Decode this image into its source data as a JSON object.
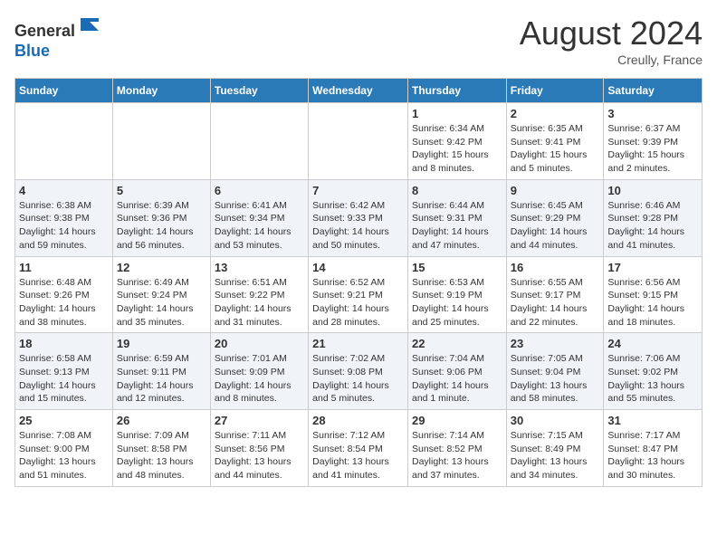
{
  "header": {
    "logo_line1": "General",
    "logo_line2": "Blue",
    "month_year": "August 2024",
    "location": "Creully, France"
  },
  "days_of_week": [
    "Sunday",
    "Monday",
    "Tuesday",
    "Wednesday",
    "Thursday",
    "Friday",
    "Saturday"
  ],
  "weeks": [
    [
      {
        "day": "",
        "sunrise": "",
        "sunset": "",
        "daylight": ""
      },
      {
        "day": "",
        "sunrise": "",
        "sunset": "",
        "daylight": ""
      },
      {
        "day": "",
        "sunrise": "",
        "sunset": "",
        "daylight": ""
      },
      {
        "day": "",
        "sunrise": "",
        "sunset": "",
        "daylight": ""
      },
      {
        "day": "1",
        "sunrise": "Sunrise: 6:34 AM",
        "sunset": "Sunset: 9:42 PM",
        "daylight": "Daylight: 15 hours and 8 minutes."
      },
      {
        "day": "2",
        "sunrise": "Sunrise: 6:35 AM",
        "sunset": "Sunset: 9:41 PM",
        "daylight": "Daylight: 15 hours and 5 minutes."
      },
      {
        "day": "3",
        "sunrise": "Sunrise: 6:37 AM",
        "sunset": "Sunset: 9:39 PM",
        "daylight": "Daylight: 15 hours and 2 minutes."
      }
    ],
    [
      {
        "day": "4",
        "sunrise": "Sunrise: 6:38 AM",
        "sunset": "Sunset: 9:38 PM",
        "daylight": "Daylight: 14 hours and 59 minutes."
      },
      {
        "day": "5",
        "sunrise": "Sunrise: 6:39 AM",
        "sunset": "Sunset: 9:36 PM",
        "daylight": "Daylight: 14 hours and 56 minutes."
      },
      {
        "day": "6",
        "sunrise": "Sunrise: 6:41 AM",
        "sunset": "Sunset: 9:34 PM",
        "daylight": "Daylight: 14 hours and 53 minutes."
      },
      {
        "day": "7",
        "sunrise": "Sunrise: 6:42 AM",
        "sunset": "Sunset: 9:33 PM",
        "daylight": "Daylight: 14 hours and 50 minutes."
      },
      {
        "day": "8",
        "sunrise": "Sunrise: 6:44 AM",
        "sunset": "Sunset: 9:31 PM",
        "daylight": "Daylight: 14 hours and 47 minutes."
      },
      {
        "day": "9",
        "sunrise": "Sunrise: 6:45 AM",
        "sunset": "Sunset: 9:29 PM",
        "daylight": "Daylight: 14 hours and 44 minutes."
      },
      {
        "day": "10",
        "sunrise": "Sunrise: 6:46 AM",
        "sunset": "Sunset: 9:28 PM",
        "daylight": "Daylight: 14 hours and 41 minutes."
      }
    ],
    [
      {
        "day": "11",
        "sunrise": "Sunrise: 6:48 AM",
        "sunset": "Sunset: 9:26 PM",
        "daylight": "Daylight: 14 hours and 38 minutes."
      },
      {
        "day": "12",
        "sunrise": "Sunrise: 6:49 AM",
        "sunset": "Sunset: 9:24 PM",
        "daylight": "Daylight: 14 hours and 35 minutes."
      },
      {
        "day": "13",
        "sunrise": "Sunrise: 6:51 AM",
        "sunset": "Sunset: 9:22 PM",
        "daylight": "Daylight: 14 hours and 31 minutes."
      },
      {
        "day": "14",
        "sunrise": "Sunrise: 6:52 AM",
        "sunset": "Sunset: 9:21 PM",
        "daylight": "Daylight: 14 hours and 28 minutes."
      },
      {
        "day": "15",
        "sunrise": "Sunrise: 6:53 AM",
        "sunset": "Sunset: 9:19 PM",
        "daylight": "Daylight: 14 hours and 25 minutes."
      },
      {
        "day": "16",
        "sunrise": "Sunrise: 6:55 AM",
        "sunset": "Sunset: 9:17 PM",
        "daylight": "Daylight: 14 hours and 22 minutes."
      },
      {
        "day": "17",
        "sunrise": "Sunrise: 6:56 AM",
        "sunset": "Sunset: 9:15 PM",
        "daylight": "Daylight: 14 hours and 18 minutes."
      }
    ],
    [
      {
        "day": "18",
        "sunrise": "Sunrise: 6:58 AM",
        "sunset": "Sunset: 9:13 PM",
        "daylight": "Daylight: 14 hours and 15 minutes."
      },
      {
        "day": "19",
        "sunrise": "Sunrise: 6:59 AM",
        "sunset": "Sunset: 9:11 PM",
        "daylight": "Daylight: 14 hours and 12 minutes."
      },
      {
        "day": "20",
        "sunrise": "Sunrise: 7:01 AM",
        "sunset": "Sunset: 9:09 PM",
        "daylight": "Daylight: 14 hours and 8 minutes."
      },
      {
        "day": "21",
        "sunrise": "Sunrise: 7:02 AM",
        "sunset": "Sunset: 9:08 PM",
        "daylight": "Daylight: 14 hours and 5 minutes."
      },
      {
        "day": "22",
        "sunrise": "Sunrise: 7:04 AM",
        "sunset": "Sunset: 9:06 PM",
        "daylight": "Daylight: 14 hours and 1 minute."
      },
      {
        "day": "23",
        "sunrise": "Sunrise: 7:05 AM",
        "sunset": "Sunset: 9:04 PM",
        "daylight": "Daylight: 13 hours and 58 minutes."
      },
      {
        "day": "24",
        "sunrise": "Sunrise: 7:06 AM",
        "sunset": "Sunset: 9:02 PM",
        "daylight": "Daylight: 13 hours and 55 minutes."
      }
    ],
    [
      {
        "day": "25",
        "sunrise": "Sunrise: 7:08 AM",
        "sunset": "Sunset: 9:00 PM",
        "daylight": "Daylight: 13 hours and 51 minutes."
      },
      {
        "day": "26",
        "sunrise": "Sunrise: 7:09 AM",
        "sunset": "Sunset: 8:58 PM",
        "daylight": "Daylight: 13 hours and 48 minutes."
      },
      {
        "day": "27",
        "sunrise": "Sunrise: 7:11 AM",
        "sunset": "Sunset: 8:56 PM",
        "daylight": "Daylight: 13 hours and 44 minutes."
      },
      {
        "day": "28",
        "sunrise": "Sunrise: 7:12 AM",
        "sunset": "Sunset: 8:54 PM",
        "daylight": "Daylight: 13 hours and 41 minutes."
      },
      {
        "day": "29",
        "sunrise": "Sunrise: 7:14 AM",
        "sunset": "Sunset: 8:52 PM",
        "daylight": "Daylight: 13 hours and 37 minutes."
      },
      {
        "day": "30",
        "sunrise": "Sunrise: 7:15 AM",
        "sunset": "Sunset: 8:49 PM",
        "daylight": "Daylight: 13 hours and 34 minutes."
      },
      {
        "day": "31",
        "sunrise": "Sunrise: 7:17 AM",
        "sunset": "Sunset: 8:47 PM",
        "daylight": "Daylight: 13 hours and 30 minutes."
      }
    ]
  ]
}
